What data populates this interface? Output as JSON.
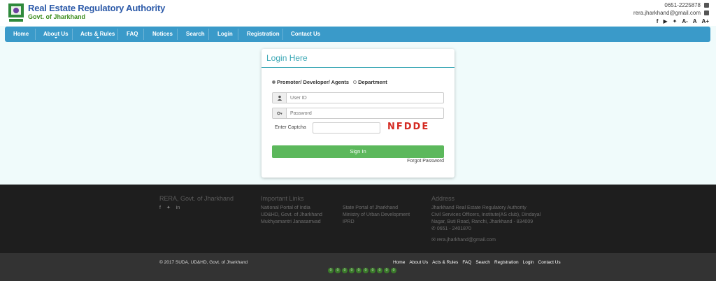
{
  "header": {
    "title": "Real Estate Regulatory Authority",
    "subtitle": "Govt. of Jharkhand",
    "phone": "0651-2225878",
    "email": "rera.jharkhand@gmail.com",
    "font_controls": [
      "A-",
      "A",
      "A+"
    ]
  },
  "nav": {
    "items": [
      "Home",
      "About Us",
      "Acts & Rules",
      "FAQ",
      "Notices",
      "Search",
      "Login",
      "Registration",
      "Contact Us"
    ]
  },
  "login": {
    "title": "Login Here",
    "role_promoter": "Promoter/ Developer/ Agents",
    "role_department": "Department",
    "userid_placeholder": "User ID",
    "password_placeholder": "Password",
    "captcha_label": "Enter Captcha",
    "captcha_text": "NFDDE",
    "signin_label": "Sign In",
    "forgot_label": "Forgot Password"
  },
  "footer": {
    "org": "RERA, Govt. of Jharkhand",
    "links_heading": "Important Links",
    "links_col1": [
      "National Portal of India",
      "UD&HD, Govt. of Jharkhand",
      "Mukhyamantri Janasamvad"
    ],
    "links_col2": [
      "State Portal of Jharkhand",
      "Ministry of Urban Development",
      "IPRD"
    ],
    "address_heading": "Address",
    "address_lines": [
      "Jharkhand Real Estate Regulatory Authority",
      "Civil Services Officers, Institute(AS club), Dindayal",
      "Nagar, Buti Road, Ranchi, Jharkhand - 834009"
    ],
    "phone": "0651 - 2401870",
    "email": "rera.jharkhand@gmail.com",
    "copyright": "© 2017 SUDA, UD&HD, Govt. of Jharkhand",
    "bottom_links": [
      "Home",
      "About Us",
      "Acts & Rules",
      "FAQ",
      "Search",
      "Registration",
      "Login",
      "Contact Us"
    ],
    "visitor_counter": [
      "0",
      "0",
      "0",
      "0",
      "0",
      "0",
      "0",
      "0",
      "0",
      "0"
    ]
  },
  "colors": {
    "nav": "#3a9ac9",
    "brand_blue": "#2b59a8",
    "brand_green": "#3e8e1f",
    "signin": "#5cb85c",
    "captcha": "#d42a22"
  }
}
